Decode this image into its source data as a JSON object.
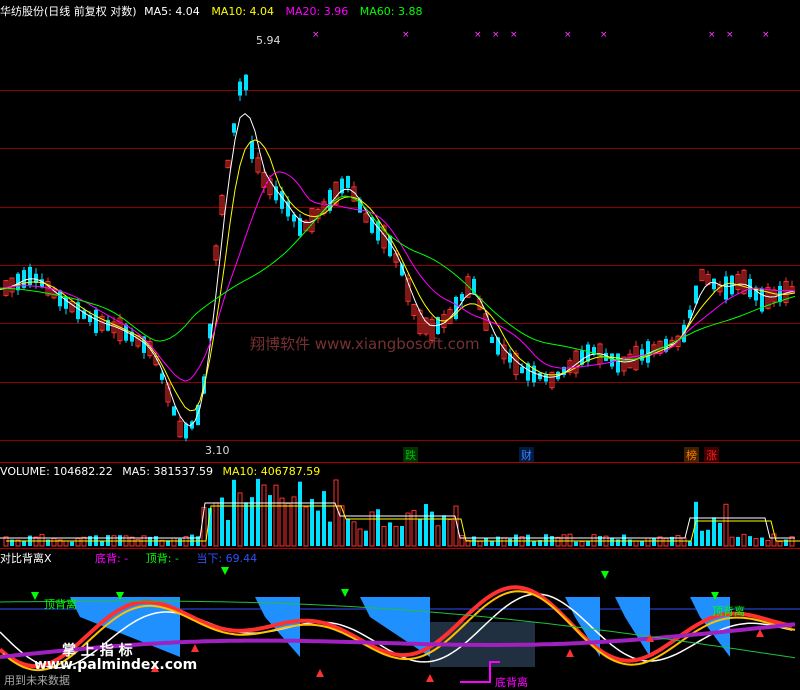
{
  "main_panel": {
    "title": "华纺股份(日线 前复权 对数)",
    "ma5_label": "MA5:",
    "ma5_value": "4.04",
    "ma10_label": "MA10:",
    "ma10_value": "4.04",
    "ma20_label": "MA20:",
    "ma20_value": "3.96",
    "ma60_label": "MA60:",
    "ma60_value": "3.88",
    "high_marker": "5.94",
    "low_marker": "3.10",
    "tags": [
      {
        "text": "跌",
        "color": "#00c000"
      },
      {
        "text": "财",
        "color": "#4080ff"
      },
      {
        "text": "榜",
        "color": "#ff8000"
      },
      {
        "text": "涨",
        "color": "#ff2020"
      }
    ],
    "watermark": "翔博软件 www.xiangbosoft.com"
  },
  "volume_panel": {
    "vol_label": "VOLUME:",
    "vol_value": "104682.22",
    "ma5_label": "MA5:",
    "ma5_value": "381537.59",
    "ma10_label": "MA10:",
    "ma10_value": "406787.59"
  },
  "indicator_panel": {
    "title": "对比背离X",
    "bottom_div_label": "底背:",
    "bottom_div_value": "-",
    "top_div_label": "顶背:",
    "top_div_value": "-",
    "extra_label": "当下:",
    "extra_value": "69.44",
    "annotations": {
      "top_div_left": "顶背离",
      "top_div_right": "顶背离",
      "bottom_div": "底背离",
      "zhang_shang": "掌 上 指 标",
      "site": "www.palmindex.com",
      "future": "用到未来数据"
    }
  },
  "colors": {
    "up": "#ff3030",
    "down": "#00e0ff",
    "ma5": "#ffffff",
    "ma10": "#ffff00",
    "ma20": "#ff00ff",
    "ma60": "#00ff00"
  }
}
